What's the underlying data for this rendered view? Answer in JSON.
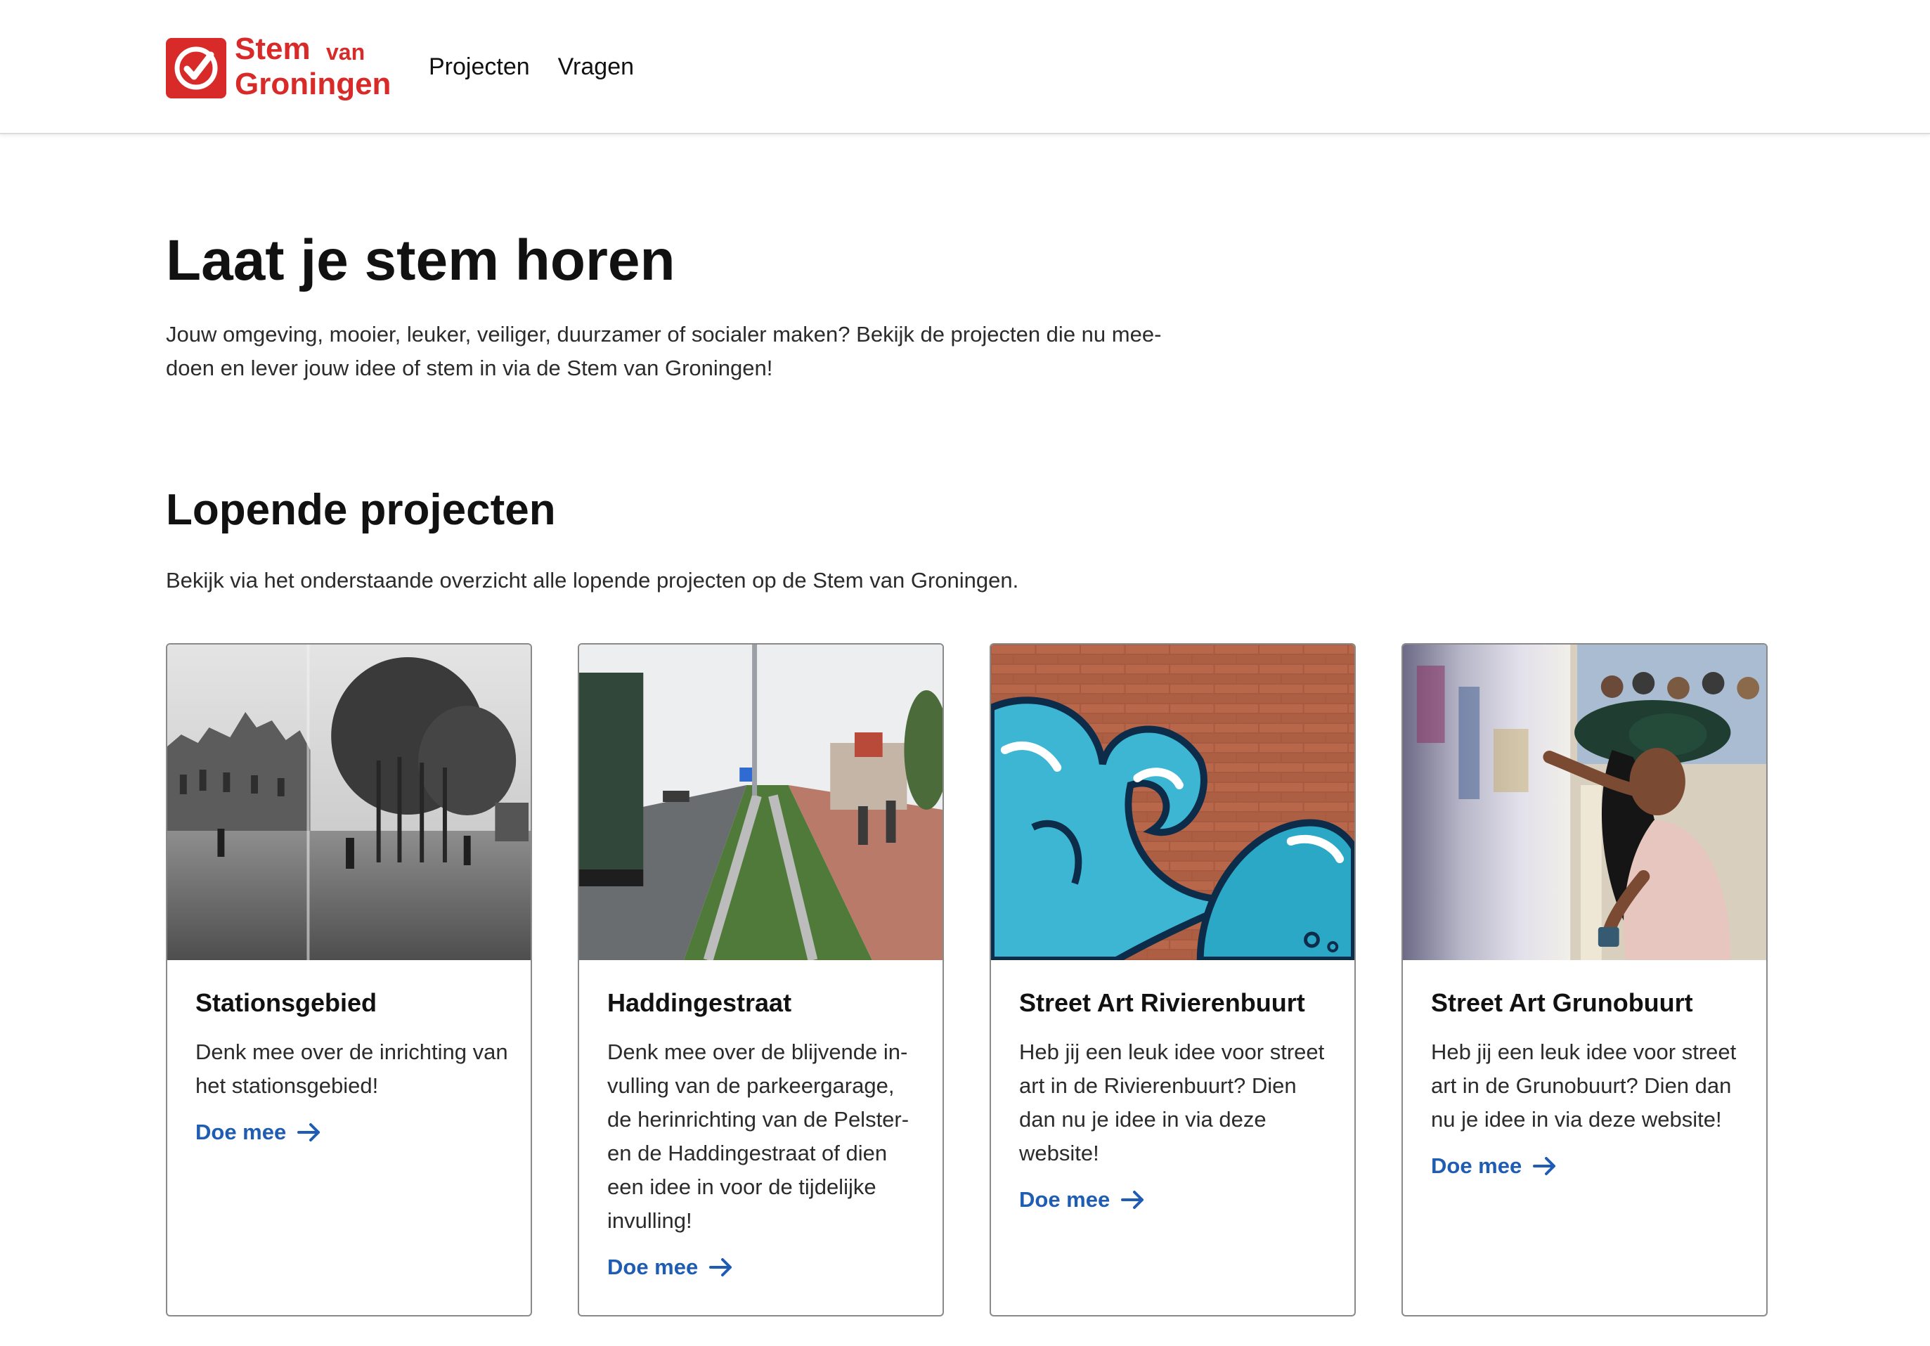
{
  "brand": {
    "stem": "Stem",
    "van": "van",
    "groningen": "Groningen",
    "accent": "#d92a2a"
  },
  "nav": {
    "items": [
      {
        "label": "Projecten"
      },
      {
        "label": "Vragen"
      }
    ]
  },
  "hero": {
    "title": "Laat je stem horen",
    "intro": "Jouw omgeving, mooier, leuker, veiliger, duurzamer of socialer maken? Bekijk de projecten die nu mee-doen en lever jouw idee of stem in via de Stem van Groningen!"
  },
  "projects": {
    "title": "Lopende projecten",
    "subtitle": "Bekijk via het onderstaande overzicht alle lopende projecten op de Stem van Groningen.",
    "link_color": "#1f5cb3",
    "cards": [
      {
        "title": "Stationsgebied",
        "description": "Denk mee over de inrichting van het stationsgebied!",
        "link": "Doe mee",
        "image": "historic-station-square-photo"
      },
      {
        "title": "Haddingestraat",
        "description": "Denk mee over de blijvende in-vulling van de parkeergarage, de herinrichting van de Pelster- en de Haddingestraat of dien een idee in voor de tijdelijke invulling!",
        "link": "Doe mee",
        "image": "road-with-cyclists-photo"
      },
      {
        "title": "Street Art Rivierenbuurt",
        "description": "Heb jij een leuk idee voor street art in de Rivierenbuurt? Dien dan nu je idee in via deze website!",
        "link": "Doe mee",
        "image": "wave-mural-on-brick-wall-photo"
      },
      {
        "title": "Street Art Grunobuurt",
        "description": "Heb jij een leuk idee voor street art in de Grunobuurt? Dien dan nu je idee in via deze website!",
        "link": "Doe mee",
        "image": "artist-painting-mural-photo"
      }
    ]
  }
}
